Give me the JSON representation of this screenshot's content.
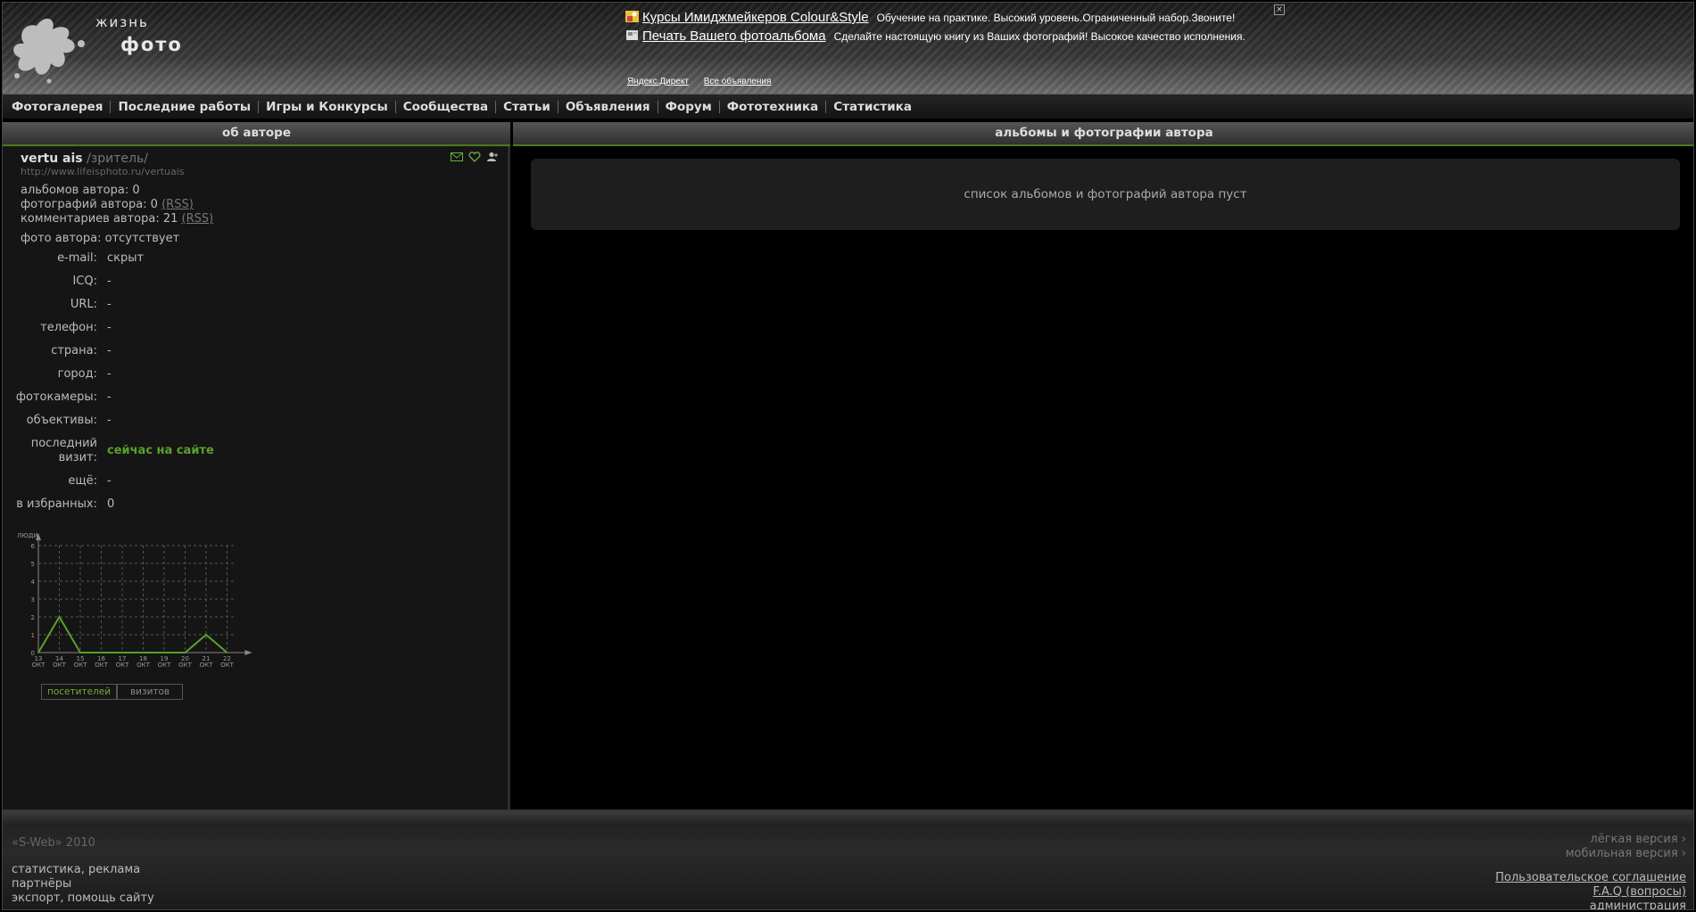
{
  "header": {
    "logo_top": "жизнь",
    "logo_bottom": "фото",
    "ads": [
      {
        "title": "Курсы Имиджмейкеров Colour&Style",
        "text": "Обучение на практике. Высокий уровень.Ограниченный набор.Звоните!"
      },
      {
        "title": "Печать Вашего фотоальбома",
        "text": "Сделайте настоящую книгу из Ваших фотографий! Высокое качество исполнения."
      }
    ],
    "ad_links": [
      "Яндекс.Директ",
      "Все объявления"
    ],
    "ad_close": "×"
  },
  "nav": [
    "Фотогалерея",
    "Последние работы",
    "Игры и Конкурсы",
    "Сообщества",
    "Статьи",
    "Объявления",
    "Форум",
    "Фототехника",
    "Статистика"
  ],
  "left_title": "об авторе",
  "right_title": "альбомы и фотографии автора",
  "user": {
    "name": "vertu ais",
    "role": "/зритель/",
    "url": "http://www.lifeisphoto.ru/vertuais",
    "albums": "альбомов автора: 0",
    "photos": "фотографий автора: 0",
    "comments": "комментариев автора: 21",
    "rss": "(RSS)",
    "photo": "фото автора: отсутствует"
  },
  "fields": [
    {
      "label": "e-mail:",
      "value": "скрыт"
    },
    {
      "label": "ICQ:",
      "value": "-"
    },
    {
      "label": "URL:",
      "value": "-"
    },
    {
      "label": "телефон:",
      "value": "-"
    },
    {
      "label": "страна:",
      "value": "-"
    },
    {
      "label": "город:",
      "value": "-"
    },
    {
      "label": "фотокамеры:",
      "value": "-"
    },
    {
      "label": "объективы:",
      "value": "-"
    },
    {
      "label": "последний визит:",
      "value": "сейчас на сайте"
    },
    {
      "label": "ещё:",
      "value": "-"
    },
    {
      "label": "в избранных:",
      "value": "0"
    }
  ],
  "chart_data": {
    "type": "line",
    "ylabel": "люди",
    "categories": [
      "13 окт",
      "14 окт",
      "15 окт",
      "16 окт",
      "17 окт",
      "18 окт",
      "19 окт",
      "20 окт",
      "21 окт",
      "22 окт"
    ],
    "y_ticks": [
      "0",
      "1",
      "2",
      "3",
      "4",
      "5",
      "6"
    ],
    "ylim": [
      0,
      6
    ],
    "series": [
      {
        "name": "посетителей",
        "values": [
          0,
          2,
          0,
          0,
          0,
          0,
          0,
          0,
          1,
          0
        ]
      }
    ],
    "grid": true,
    "line_color": "#5aa02c"
  },
  "chart_tabs": [
    "посетителей",
    "визитов"
  ],
  "empty_text": "список альбомов и фотографий автора пуст",
  "footer": {
    "copyright": "«S-Web» 2010",
    "links": [
      "статистика, реклама",
      "партнёры",
      "экспорт, помощь сайту"
    ],
    "versions": [
      "лёгкая версия ›",
      "мобильная версия ›"
    ],
    "right_links": [
      "Пользовательское соглашение",
      "F.A.Q (вопросы)",
      "администрация"
    ]
  }
}
